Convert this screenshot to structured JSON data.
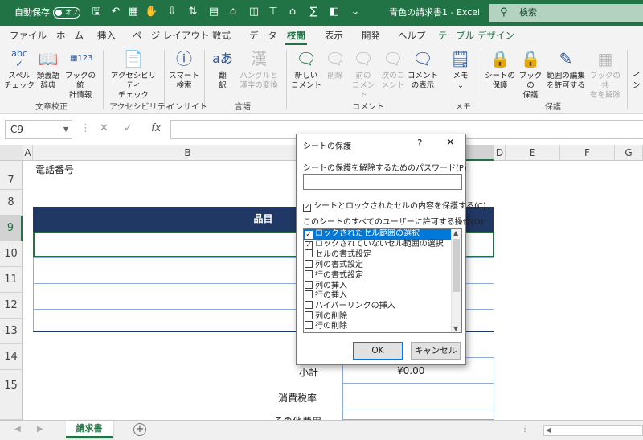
{
  "titlebar": {
    "autosave_label": "自動保存",
    "autosave_state": "オフ",
    "doc_title": "青色の請求書1 - Excel",
    "search_placeholder": "検索"
  },
  "tabs": [
    "ファイル",
    "ホーム",
    "挿入",
    "ページ レイアウト",
    "数式",
    "データ",
    "校閲",
    "表示",
    "開発",
    "ヘルプ",
    "テーブル デザイン"
  ],
  "active_tab": "校閲",
  "ribbon": {
    "buttons": [
      {
        "name": "spell-check-button",
        "label": "スペル\nチェック",
        "icon": "abc",
        "disabled": false
      },
      {
        "name": "thesaurus-button",
        "label": "類義語\n辞典",
        "icon": "book",
        "disabled": false
      },
      {
        "name": "workbook-stats-button",
        "label": "ブックの統\n計情報",
        "icon": "123",
        "disabled": false
      },
      {
        "name": "accessibility-button",
        "label": "アクセシビリティ\nチェック",
        "icon": "accessibility",
        "disabled": false
      },
      {
        "name": "smart-lookup-button",
        "label": "スマート\n検索",
        "icon": "search",
        "disabled": false
      },
      {
        "name": "translate-button",
        "label": "翻\n訳",
        "icon": "translate",
        "disabled": false
      },
      {
        "name": "hanzi-convert-button",
        "label": "ハングルと\n漢字の変換",
        "icon": "漢",
        "disabled": true
      },
      {
        "name": "new-comment-button",
        "label": "新しい\nコメント",
        "icon": "comment-plus",
        "disabled": false
      },
      {
        "name": "delete-comment-button",
        "label": "削除",
        "icon": "comment-x",
        "disabled": true
      },
      {
        "name": "prev-comment-button",
        "label": "前の\nコメント",
        "icon": "comment-prev",
        "disabled": true
      },
      {
        "name": "next-comment-button",
        "label": "次のコ\nメント",
        "icon": "comment-next",
        "disabled": true
      },
      {
        "name": "show-comments-button",
        "label": "コメント\nの表示",
        "icon": "comment",
        "disabled": false
      },
      {
        "name": "memo-button",
        "label": "メモ\n⌄",
        "icon": "note",
        "disabled": false
      },
      {
        "name": "protect-sheet-button",
        "label": "シートの\n保護",
        "icon": "sheet-lock",
        "disabled": false
      },
      {
        "name": "protect-workbook-button",
        "label": "ブックの\n保護",
        "icon": "book-lock",
        "disabled": false
      },
      {
        "name": "allow-edit-ranges-button",
        "label": "範囲の編集\nを許可する",
        "icon": "edit-range",
        "disabled": false
      },
      {
        "name": "unshare-workbook-button",
        "label": "ブックの共\n有を解除",
        "icon": "unshare",
        "disabled": true
      },
      {
        "name": "ink-button",
        "label": "イ\nン",
        "icon": "ink",
        "disabled": false
      }
    ],
    "groups": [
      "文章校正",
      "アクセシビリティ",
      "インサイト",
      "言語",
      "コメント",
      "メモ",
      "保護"
    ]
  },
  "formula_bar": {
    "name_box": "C9",
    "fx_label": "fx",
    "formula": ""
  },
  "grid": {
    "columns": [
      "A",
      "B",
      "D",
      "E",
      "F",
      "G"
    ],
    "rows": [
      "7",
      "8",
      "9",
      "10",
      "11",
      "12",
      "13",
      "14",
      "15"
    ],
    "cells": {
      "phone_label": "電話番号",
      "item_header": "品目",
      "subtotal_label": "小計",
      "subtotal_value": "¥0.00",
      "tax_label": "消費税率",
      "other_label": "その他費用"
    }
  },
  "sheet": {
    "tab": "請求書"
  },
  "dialog": {
    "title": "シートの保護",
    "help": "?",
    "password_label": "シートの保護を解除するためのパスワード(P)",
    "password_value": "",
    "protect_checkbox_label": "シートとロックされたセルの内容を保護する(C)",
    "protect_checked": true,
    "allow_label": "このシートのすべてのユーザーに許可する操作(O):",
    "permissions": [
      {
        "label": "ロックされたセル範囲の選択",
        "checked": true,
        "selected": true
      },
      {
        "label": "ロックされていないセル範囲の選択",
        "checked": true,
        "selected": false
      },
      {
        "label": "セルの書式設定",
        "checked": false,
        "selected": false
      },
      {
        "label": "列の書式設定",
        "checked": false,
        "selected": false
      },
      {
        "label": "行の書式設定",
        "checked": false,
        "selected": false
      },
      {
        "label": "列の挿入",
        "checked": false,
        "selected": false
      },
      {
        "label": "行の挿入",
        "checked": false,
        "selected": false
      },
      {
        "label": "ハイパーリンクの挿入",
        "checked": false,
        "selected": false
      },
      {
        "label": "列の削除",
        "checked": false,
        "selected": false
      },
      {
        "label": "行の削除",
        "checked": false,
        "selected": false
      }
    ],
    "ok": "OK",
    "cancel": "キャンセル"
  }
}
